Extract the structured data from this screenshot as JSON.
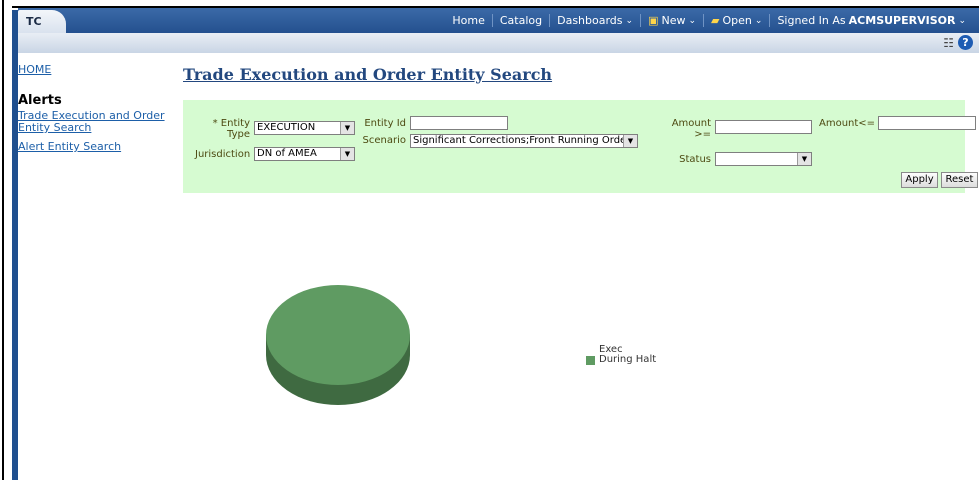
{
  "app_tab": "TC",
  "nav": {
    "home": "Home",
    "catalog": "Catalog",
    "dashboards": "Dashboards",
    "new": "New",
    "open": "Open",
    "signed_in_as": "Signed In As",
    "user": "ACMSUPERVISOR"
  },
  "sidebar": {
    "home_link": "HOME",
    "section_title": "Alerts",
    "links": [
      "Trade Execution and Order Entity Search",
      "Alert Entity Search"
    ]
  },
  "page": {
    "title": "Trade Execution and Order Entity Search"
  },
  "search": {
    "entity_type_label": "* Entity Type",
    "entity_type_value": "EXECUTION",
    "jurisdiction_label": "Jurisdiction",
    "jurisdiction_value": "DN of AMEA",
    "entity_id_label": "Entity Id",
    "entity_id_value": "",
    "scenario_label": "Scenario",
    "scenario_value": "Significant Corrections;Front Running Orders",
    "amount_gte_label": "Amount >=",
    "amount_gte_value": "",
    "amount_lte_label": "Amount<=",
    "amount_lte_value": "",
    "status_label": "Status",
    "status_value": "",
    "apply_label": "Apply",
    "reset_label": "Reset"
  },
  "chart_data": {
    "type": "pie",
    "slices": [
      {
        "label": "Exec During Halt",
        "value": 100,
        "color": "#5f9b62"
      }
    ],
    "legend_position": "right"
  },
  "colors": {
    "header_blue": "#24508f",
    "search_panel": "#d6fbd1",
    "link": "#1d5fa8",
    "pie_top": "#5f9b62",
    "pie_side": "#3f6a41"
  }
}
